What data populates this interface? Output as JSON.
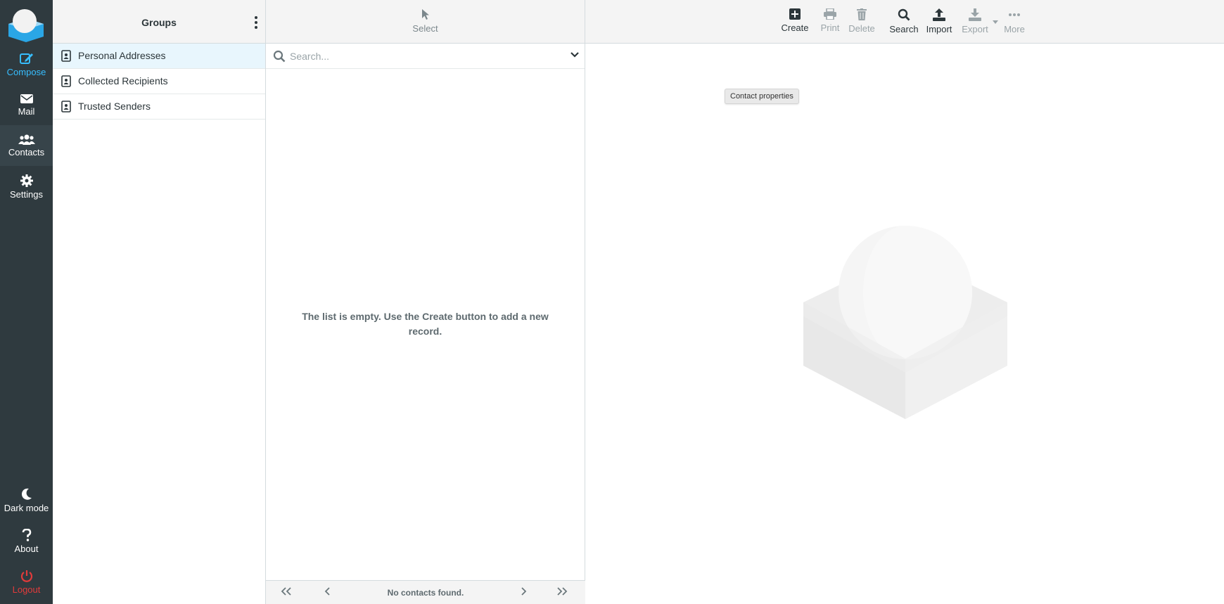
{
  "nav": {
    "compose": "Compose",
    "mail": "Mail",
    "contacts": "Contacts",
    "settings": "Settings",
    "dark_mode": "Dark mode",
    "about": "About",
    "logout": "Logout"
  },
  "groups": {
    "title": "Groups",
    "items": [
      {
        "label": "Personal Addresses",
        "selected": true
      },
      {
        "label": "Collected Recipients",
        "selected": false
      },
      {
        "label": "Trusted Senders",
        "selected": false
      }
    ]
  },
  "list": {
    "select_label": "Select",
    "search_placeholder": "Search...",
    "empty_message": "The list is empty. Use the Create button to add a new record.",
    "footer_text": "No contacts found."
  },
  "toolbar": {
    "create": "Create",
    "print": "Print",
    "delete": "Delete",
    "search": "Search",
    "import": "Import",
    "export": "Export",
    "more": "More"
  },
  "content": {
    "tooltip": "Contact properties"
  },
  "colors": {
    "nav_bg": "#2f3a3f",
    "accent": "#37beff",
    "logout": "#e23b3b",
    "selected_row": "#e8f6fd"
  }
}
